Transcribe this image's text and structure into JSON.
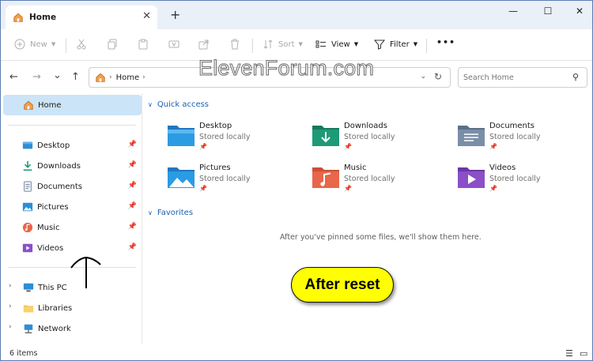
{
  "titlebar": {
    "tab_title": "Home",
    "tab_close": "✕",
    "new_tab": "+",
    "minimize": "—",
    "maximize": "☐",
    "close": "✕"
  },
  "commands": {
    "new_label": "New",
    "sort_label": "Sort",
    "view_label": "View",
    "filter_label": "Filter",
    "more_label": "•••"
  },
  "address": {
    "back": "←",
    "forward": "→",
    "recent": "⌄",
    "up": "↑",
    "crumb": "Home",
    "search_placeholder": "Search Home"
  },
  "watermark": "ElevenForum.com",
  "sidebar": {
    "home": "Home",
    "pinned": [
      {
        "label": "Desktop",
        "icon": "desktop-icon",
        "color": "#2b8fd6"
      },
      {
        "label": "Downloads",
        "icon": "downloads-icon",
        "color": "#1f9a76"
      },
      {
        "label": "Documents",
        "icon": "documents-icon",
        "color": "#6b7e95"
      },
      {
        "label": "Pictures",
        "icon": "pictures-icon",
        "color": "#2b8fd6"
      },
      {
        "label": "Music",
        "icon": "music-icon",
        "color": "#e8664a"
      },
      {
        "label": "Videos",
        "icon": "videos-icon",
        "color": "#8b4fc7"
      }
    ],
    "locations": [
      {
        "label": "This PC",
        "icon": "this-pc-icon"
      },
      {
        "label": "Libraries",
        "icon": "libraries-icon"
      },
      {
        "label": "Network",
        "icon": "network-icon"
      }
    ]
  },
  "main": {
    "quick_access_label": "Quick access",
    "favorites_label": "Favorites",
    "favorites_empty": "After you've pinned some files, we'll show them here.",
    "tiles": [
      {
        "name": "Desktop",
        "sub": "Stored locally",
        "color": "#2b8fd6"
      },
      {
        "name": "Downloads",
        "sub": "Stored locally",
        "color": "#1f9a76"
      },
      {
        "name": "Documents",
        "sub": "Stored locally",
        "color": "#7a8ea8"
      },
      {
        "name": "Pictures",
        "sub": "Stored locally",
        "color": "#2b8fd6"
      },
      {
        "name": "Music",
        "sub": "Stored locally",
        "color": "#e8664a"
      },
      {
        "name": "Videos",
        "sub": "Stored locally",
        "color": "#8b4fc7"
      }
    ]
  },
  "annotation": {
    "badge_text": "After reset"
  },
  "status": {
    "item_count": "6 items"
  }
}
